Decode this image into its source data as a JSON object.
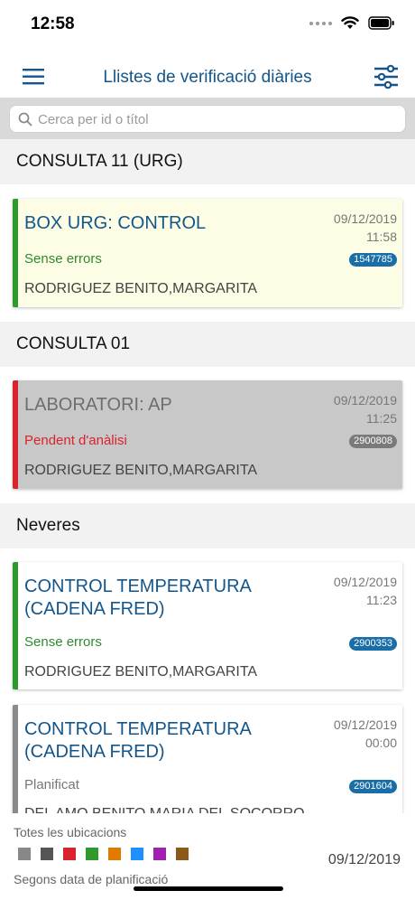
{
  "status_bar": {
    "time": "12:58"
  },
  "header": {
    "title": "Llistes de verificació diàries"
  },
  "search": {
    "placeholder": "Cerca per id o títol"
  },
  "sections": [
    {
      "label": "CONSULTA 11 (URG)"
    },
    {
      "label": "CONSULTA 01"
    },
    {
      "label": "Neveres"
    }
  ],
  "cards": [
    {
      "title": "BOX URG: CONTROL",
      "date": "09/12/2019",
      "time": "11:58",
      "status": "Sense errors",
      "id": "1547785",
      "person": "RODRIGUEZ BENITO,MARGARITA",
      "accent": "#2e9a2e",
      "background": "#fdfde6",
      "title_color": "#12568c",
      "status_color": "#2e8b2e",
      "badge_color": "#1a6ea8"
    },
    {
      "title": "LABORATORI: AP",
      "date": "09/12/2019",
      "time": "11:25",
      "status": "Pendent d'anàlisi",
      "id": "2900808",
      "person": "RODRIGUEZ BENITO,MARGARITA",
      "accent": "#d9232d",
      "background": "#c8c8c8",
      "title_color": "#6e6e6e",
      "status_color": "#d9232d",
      "badge_color": "#7a7a7a"
    },
    {
      "title": "CONTROL TEMPERATURA (CADENA FRED)",
      "date": "09/12/2019",
      "time": "11:23",
      "status": "Sense errors",
      "id": "2900353",
      "person": "RODRIGUEZ BENITO,MARGARITA",
      "accent": "#2e9a2e",
      "background": "#ffffff",
      "title_color": "#12568c",
      "status_color": "#2e8b2e",
      "badge_color": "#1a6ea8"
    },
    {
      "title": "CONTROL TEMPERATURA (CADENA FRED)",
      "date": "09/12/2019",
      "time": "00:00",
      "status": "Planificat",
      "id": "2901604",
      "person": "DEL AMO BENITO,MARIA DEL SOCORRO",
      "accent": "#8a8a8a",
      "background": "#ffffff",
      "title_color": "#12568c",
      "status_color": "#777777",
      "badge_color": "#1a6ea8"
    }
  ],
  "footer": {
    "location_label": "Totes les ubicacions",
    "legend_colors": [
      "#888888",
      "#555555",
      "#d9232d",
      "#2e9a2e",
      "#e07b00",
      "#1e90ff",
      "#a020b0",
      "#8b5a1a"
    ],
    "date": "09/12/2019",
    "order_label": "Segons data de planificació"
  },
  "theme": {
    "accent": "#12568c"
  }
}
